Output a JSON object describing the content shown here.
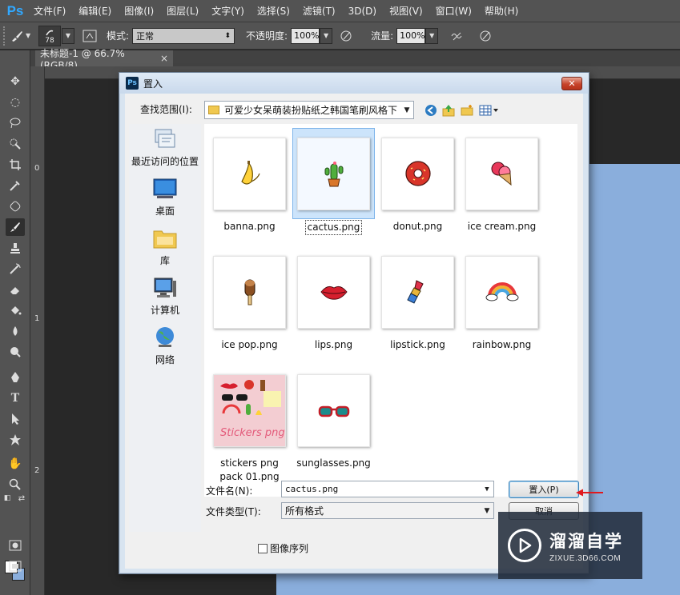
{
  "app": {
    "logo": "Ps",
    "menu": [
      "文件(F)",
      "编辑(E)",
      "图像(I)",
      "图层(L)",
      "文字(Y)",
      "选择(S)",
      "滤镜(T)",
      "3D(D)",
      "视图(V)",
      "窗口(W)",
      "帮助(H)"
    ]
  },
  "options": {
    "brush_size": "78",
    "mode_label": "模式:",
    "mode_value": "正常",
    "opacity_label": "不透明度:",
    "opacity_value": "100%",
    "flow_label": "流量:",
    "flow_value": "100%"
  },
  "document": {
    "tab_title": "未标题-1 @ 66.7%(RGB/8)",
    "tab_close": "×",
    "ruler_left_marks": [
      "0",
      "1",
      "2"
    ],
    "canvas_color": "#8aaedc"
  },
  "dialog": {
    "title": "置入",
    "close": "✕",
    "look_in_label": "查找范围(I):",
    "look_in_value": "可爱少女呆萌装扮贴纸之韩国笔刷风格下",
    "places": [
      {
        "label": "最近访问的位置",
        "icon": "recent-places-icon"
      },
      {
        "label": "桌面",
        "icon": "desktop-icon"
      },
      {
        "label": "库",
        "icon": "libraries-icon"
      },
      {
        "label": "计算机",
        "icon": "computer-icon"
      },
      {
        "label": "网络",
        "icon": "network-icon"
      }
    ],
    "files": [
      {
        "name": "banna.png",
        "icon": "banana-icon",
        "selected": false
      },
      {
        "name": "cactus.png",
        "icon": "cactus-icon",
        "selected": true
      },
      {
        "name": "donut.png",
        "icon": "donut-icon",
        "selected": false
      },
      {
        "name": "ice cream.png",
        "icon": "ice-cream-icon",
        "selected": false
      },
      {
        "name": "ice pop.png",
        "icon": "ice-pop-icon",
        "selected": false
      },
      {
        "name": "lips.png",
        "icon": "lips-icon",
        "selected": false
      },
      {
        "name": "lipstick.png",
        "icon": "lipstick-icon",
        "selected": false
      },
      {
        "name": "rainbow.png",
        "icon": "rainbow-icon",
        "selected": false
      },
      {
        "name": "stickers png pack 01.png",
        "icon": "stickers-pack-preview",
        "selected": false
      },
      {
        "name": "sunglasses.png",
        "icon": "sunglasses-icon",
        "selected": false
      }
    ],
    "file_name_label": "文件名(N):",
    "file_name_value": "cactus.png",
    "file_type_label": "文件类型(T):",
    "file_type_value": "所有格式",
    "place_button": "置入(P)",
    "cancel_button": "取消",
    "image_sequence_label": "图像序列",
    "image_sequence_checked": false
  },
  "watermark": {
    "title": "溜溜自学",
    "subtitle": "ZIXUE.3D66.COM"
  }
}
